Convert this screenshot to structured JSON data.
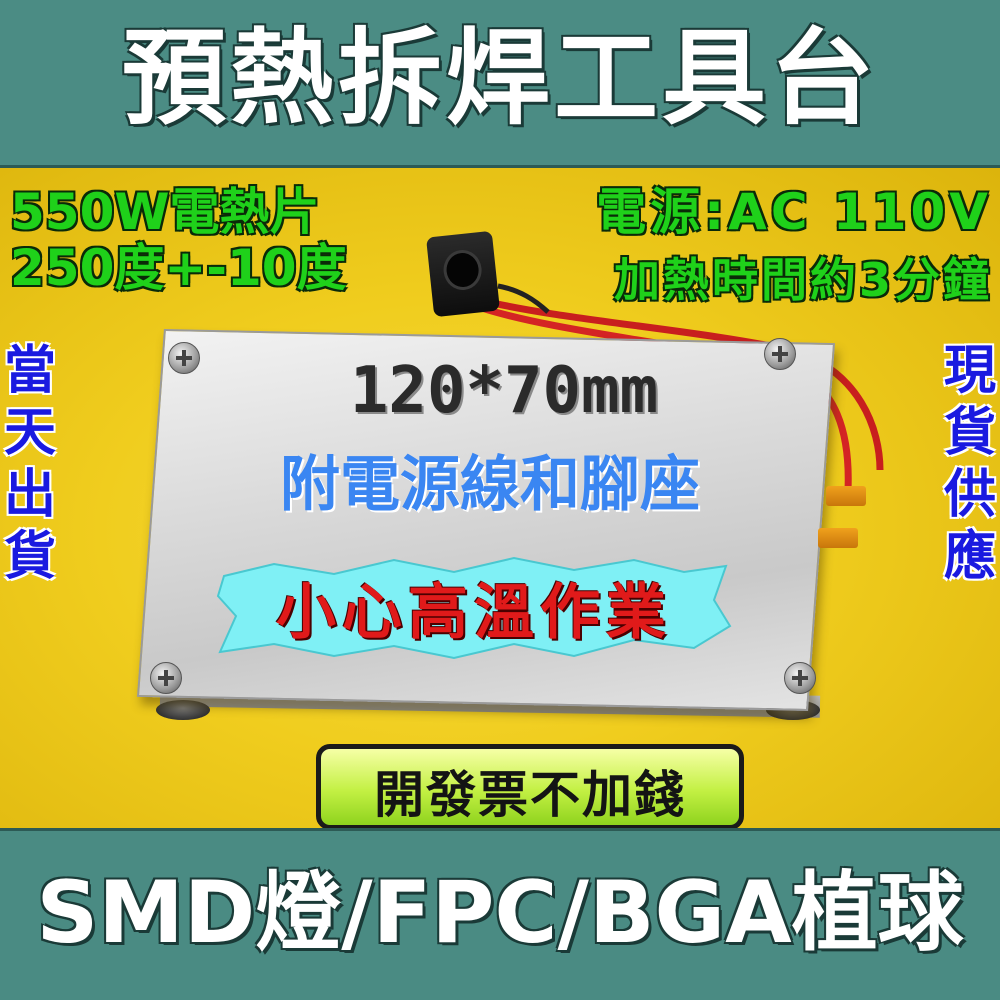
{
  "title": "預熱拆焊工具台",
  "specs_left": {
    "line1": "550W電熱片",
    "line2": "250度+-10度"
  },
  "specs_right": {
    "line1": "電源:AC 110V",
    "line2": "加熱時間約3分鐘"
  },
  "side_left": "當天出貨",
  "side_right": "現貨供應",
  "dimensions": "120*70mm",
  "accessory_note": "附電源線和腳座",
  "warning": "小心高溫作業",
  "invoice_note": "開發票不加錢",
  "footer": "SMD燈/FPC/BGA植球",
  "colors": {
    "banner": "#4b8c84",
    "background": "#f0cd1e",
    "spec_green": "#1fd11a",
    "side_blue": "#1a1ae0",
    "accessory_blue": "#3a86f2",
    "warning_red": "#e01a1a",
    "burst_cyan": "#7ff0f5",
    "invoice_green": "#c3f043"
  }
}
